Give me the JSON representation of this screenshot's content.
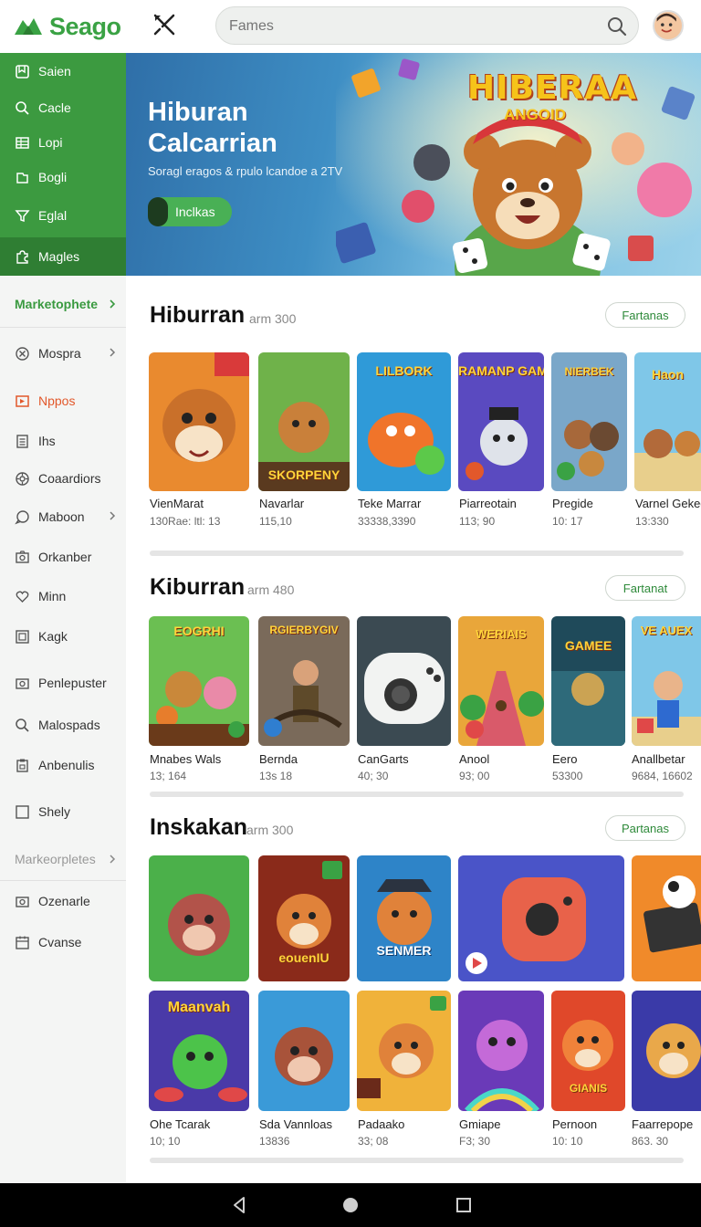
{
  "app": {
    "name": "Seago"
  },
  "search": {
    "placeholder": "Fames"
  },
  "icons": {
    "logo": "leaf-logo-icon",
    "tool": "cross-tool-icon",
    "search": "search-icon",
    "avatar": "user-avatar"
  },
  "colors": {
    "brand_green": "#3aa244",
    "sidebar_green": "#3c9a40",
    "accent_orange": "#e2582b"
  },
  "sidebar": {
    "top_items": [
      {
        "label": "Saien",
        "icon": "bookmark-icon"
      },
      {
        "label": "Cacle",
        "icon": "search-icon"
      },
      {
        "label": "Lopi",
        "icon": "grid-icon"
      },
      {
        "label": "Bogli",
        "icon": "folder-icon"
      },
      {
        "label": "Eglal",
        "icon": "funnel-icon"
      },
      {
        "label": "Magles",
        "icon": "puzzle-icon"
      }
    ],
    "section1": "Marketophete",
    "items": [
      {
        "label": "Mospra",
        "icon": "circle-x-icon",
        "chevron": true
      },
      {
        "label": "Nppos",
        "icon": "play-box-icon",
        "chevron": false
      },
      {
        "label": "Ihs",
        "icon": "list-icon",
        "chevron": false
      },
      {
        "label": "Coaardiors",
        "icon": "gear-icon",
        "chevron": false
      },
      {
        "label": "Maboon",
        "icon": "chat-icon",
        "chevron": true
      },
      {
        "label": "Orkanber",
        "icon": "camera-icon",
        "chevron": false
      },
      {
        "label": "Minn",
        "icon": "heart-icon",
        "chevron": false
      },
      {
        "label": "Kagk",
        "icon": "frame-icon",
        "chevron": false
      },
      {
        "label": "Penlepuster",
        "icon": "camera-icon",
        "chevron": false
      },
      {
        "label": "Malospads",
        "icon": "search-icon",
        "chevron": false
      },
      {
        "label": "Anbenulis",
        "icon": "clipboard-icon",
        "chevron": false
      },
      {
        "label": "Shely",
        "icon": "square-icon",
        "chevron": false
      }
    ],
    "section2": "Markeorpletes",
    "bottom_items": [
      {
        "label": "Ozenarle",
        "icon": "camera-icon"
      },
      {
        "label": "Cvanse",
        "icon": "calendar-icon"
      }
    ]
  },
  "banner": {
    "title_line1": "Hiburan",
    "title_line2": "Calcarrian",
    "subtitle": "Soragl eragos & rpulo lcandoe a 2TV",
    "button": "Inclkas",
    "art_title": "HIBERAA",
    "art_subtitle": "ANGOID"
  },
  "sections": [
    {
      "title": "Hiburran",
      "meta": "arm 300",
      "action": "Fartanas",
      "cards": [
        {
          "name": "VienMarat",
          "meta": "130Rae: ltl: 13",
          "label": ""
        },
        {
          "name": "Navarlar",
          "meta": "115,10",
          "label": "SKORPENY"
        },
        {
          "name": "Teke Marrar",
          "meta": "33338,3390",
          "label": "LILBORK"
        },
        {
          "name": "Piarreotain",
          "meta": "113; 90",
          "label": "RAMANP GAME"
        },
        {
          "name": "Pregide",
          "meta": "10: 17",
          "label": "NIERBEK"
        },
        {
          "name": "Varnel Gekec",
          "meta": "13:330",
          "label": "Haon"
        }
      ]
    },
    {
      "title": "Kiburran",
      "meta": "arm 480",
      "action": "Fartanat",
      "cards": [
        {
          "name": "Mnabes Wals",
          "meta": "13; 164",
          "label": "EOGRHI"
        },
        {
          "name": "Bernda",
          "meta": "13s 18",
          "label": "RGIERBYGIV"
        },
        {
          "name": "CanGarts",
          "meta": "40; 30",
          "label": ""
        },
        {
          "name": "Anool",
          "meta": "93; 00",
          "label": "WERIAIS"
        },
        {
          "name": "Eero",
          "meta": "53300",
          "label": "GAMEE"
        },
        {
          "name": "Anallbetar",
          "meta": "9684, 16602",
          "label": "VE AUEX"
        }
      ]
    },
    {
      "title": "Inskakan",
      "meta": "arm 300",
      "action": "Partanas",
      "cards_row1": [
        {
          "label": ""
        },
        {
          "label": "eouenIU"
        },
        {
          "label": "SENMER"
        },
        {
          "label": ""
        },
        {
          "label": ""
        }
      ],
      "cards_row2": [
        {
          "name": "Ohe Tcarak",
          "meta": "10; 10",
          "label": "Maanvah"
        },
        {
          "name": "Sda Vannloas",
          "meta": "13836",
          "label": ""
        },
        {
          "name": "Padaako",
          "meta": "33; 08",
          "label": ""
        },
        {
          "name": "Gmiape",
          "meta": "F3; 30",
          "label": ""
        },
        {
          "name": "Pernoon",
          "meta": "10: 10",
          "label": "GIANIS"
        },
        {
          "name": "Faarrepope",
          "meta": "863. 30",
          "label": ""
        }
      ]
    }
  ]
}
